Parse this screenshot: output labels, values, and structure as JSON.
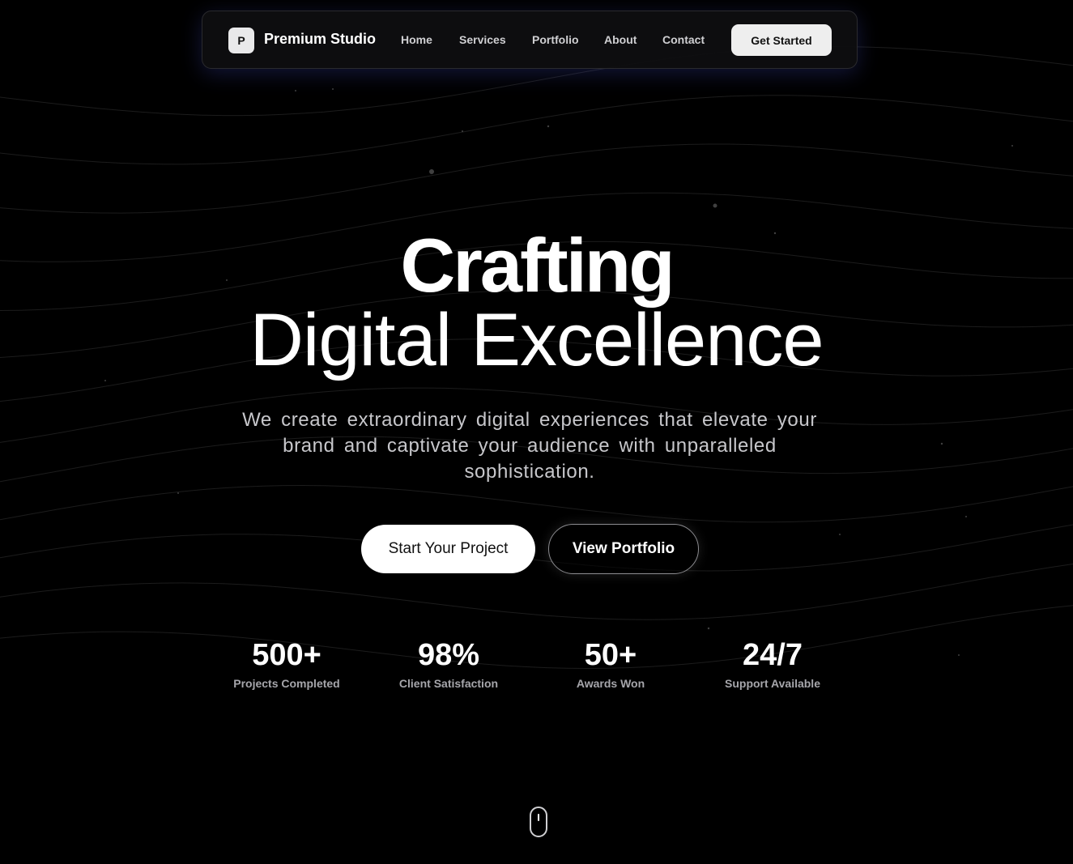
{
  "nav": {
    "logo_letter": "P",
    "brand": "Premium Studio",
    "links": [
      "Home",
      "Services",
      "Portfolio",
      "About",
      "Contact"
    ],
    "cta": "Get Started"
  },
  "hero": {
    "title_line1": "Crafting",
    "title_line2": "Digital Excellence",
    "subtitle": "We create extraordinary digital experiences that elevate your brand and captivate your audience with unparalleled sophistication.",
    "primary_button": "Start Your Project",
    "secondary_button": "View Portfolio"
  },
  "stats": [
    {
      "value": "500+",
      "label": "Projects Completed"
    },
    {
      "value": "98%",
      "label": "Client Satisfaction"
    },
    {
      "value": "50+",
      "label": "Awards Won"
    },
    {
      "value": "24/7",
      "label": "Support Available"
    }
  ],
  "icons": {
    "scroll": "mouse-scroll-icon"
  },
  "colors": {
    "background": "#000000",
    "text": "#ffffff",
    "muted_text": "#a6a6ab",
    "nav_glow": "#4650c8"
  }
}
